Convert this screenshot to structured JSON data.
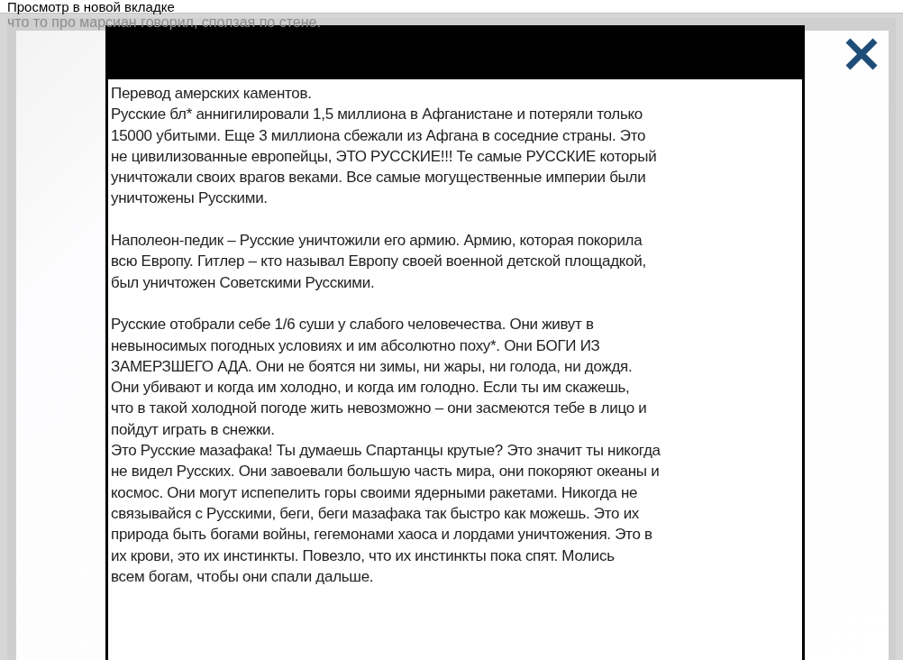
{
  "tooltip": "Просмотр в новой вкладке",
  "background_text": "что то про марсиан говорил, сползая по стене.",
  "document": {
    "sections": [
      {
        "paragraphs": [
          {
            "lines": [
              "Перевод амерских каментов."
            ]
          },
          {
            "lines": [
              "Русские бл* аннигилировали 1,5 миллиона в Афганистане и потеряли только",
              "15000 убитыми. Еще 3 миллиона сбежали из Афгана в соседние страны. Это",
              "не цивилизованные европейцы, ЭТО РУССКИЕ!!! Те самые РУССКИЕ который",
              "уничтожали своих врагов веками. Все самые могущественные империи были",
              "уничтожены Русскими."
            ]
          }
        ]
      },
      {
        "paragraphs": [
          {
            "lines": [
              "Наполеон-педик – Русские уничтожили его армию. Армию, которая покорила",
              "всю Европу. Гитлер – кто называл Европу своей военной детской площадкой,",
              "был уничтожен Советскими Русскими."
            ]
          }
        ]
      },
      {
        "paragraphs": [
          {
            "lines": [
              "Русские отобрали себе 1/6 суши у слабого человечества. Они живут в",
              "невыносимых погодных условиях и им абсолютно поху*. Они БОГИ ИЗ",
              "ЗАМЕРЗШЕГО АДА. Они не боятся ни зимы, ни жары, ни голода, ни дождя.",
              "Они убивают и когда им холодно, и когда им голодно. Если ты им скажешь,",
              "что в такой холодной погоде жить невозможно – они засмеются тебе в лицо и",
              "пойдут играть в снежки."
            ]
          },
          {
            "lines": [
              "Это Русские мазафака! Ты думаешь Спартанцы крутые? Это значит ты никогда",
              "не видел Русских. Они завоевали большую часть мира, они покоряют океаны и",
              "космос. Они могут испепелить горы своими ядерными ракетами. Никогда не",
              "связывайся с Русскими, беги, беги мазафака так быстро как можешь. Это их",
              "природа быть богами войны, гегемонами хаоса и лордами уничтожения. Это в",
              "их крови, это их инстинкты. Повезло, что их инстинкты пока спят. Молись",
              "всем богам, чтобы они спали дальше."
            ]
          }
        ]
      }
    ]
  }
}
